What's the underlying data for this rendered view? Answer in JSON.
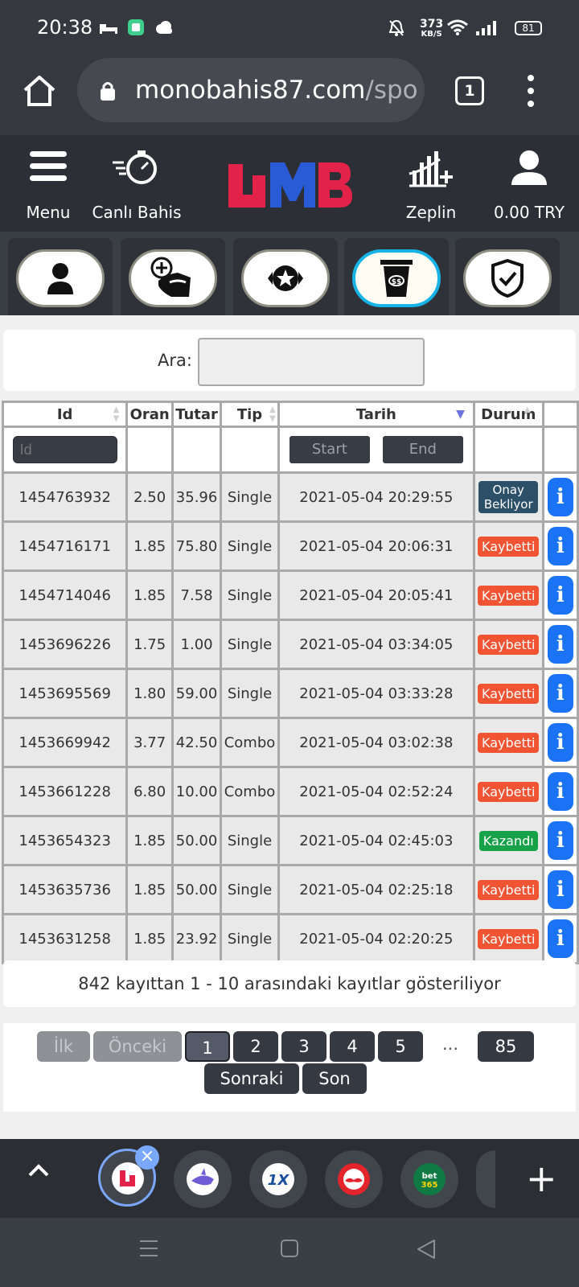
{
  "status_bar": {
    "time": "20:38",
    "net_speed_value": "373",
    "net_speed_unit": "KB/S",
    "battery": "81"
  },
  "browser": {
    "url_host": "monobahis87.com",
    "url_path": "/spor",
    "tab_count": "1"
  },
  "site_header": {
    "menu_label": "Menu",
    "live_label": "Canlı Bahis",
    "zeplin_label": "Zeplin",
    "balance_label": "0.00 TRY",
    "logo_text": "MB",
    "brand_colors": {
      "blue": "#2a5bd7",
      "red": "#e3224a"
    }
  },
  "icon_tabs": [
    {
      "icon": "user-icon"
    },
    {
      "icon": "deposit-icon"
    },
    {
      "icon": "star-badge-icon"
    },
    {
      "icon": "coupon-icon",
      "active": true
    },
    {
      "icon": "shield-check-icon"
    }
  ],
  "search": {
    "label": "Ara:",
    "value": ""
  },
  "table": {
    "headers": {
      "id": "Id",
      "oran": "Oran",
      "tutar": "Tutar",
      "tip": "Tip",
      "tarih": "Tarih",
      "durum": "Durum"
    },
    "filters": {
      "id_placeholder": "Id",
      "start": "Start",
      "end": "End"
    },
    "rows": [
      {
        "id": "1454763932",
        "oran": "2.50",
        "tutar": "35.96",
        "tip": "Single",
        "tarih": "2021-05-04 20:29:55",
        "durum": "Onay Bekliyor",
        "status": "pending"
      },
      {
        "id": "1454716171",
        "oran": "1.85",
        "tutar": "75.80",
        "tip": "Single",
        "tarih": "2021-05-04 20:06:31",
        "durum": "Kaybetti",
        "status": "lost"
      },
      {
        "id": "1454714046",
        "oran": "1.85",
        "tutar": "7.58",
        "tip": "Single",
        "tarih": "2021-05-04 20:05:41",
        "durum": "Kaybetti",
        "status": "lost"
      },
      {
        "id": "1453696226",
        "oran": "1.75",
        "tutar": "1.00",
        "tip": "Single",
        "tarih": "2021-05-04 03:34:05",
        "durum": "Kaybetti",
        "status": "lost"
      },
      {
        "id": "1453695569",
        "oran": "1.80",
        "tutar": "59.00",
        "tip": "Single",
        "tarih": "2021-05-04 03:33:28",
        "durum": "Kaybetti",
        "status": "lost"
      },
      {
        "id": "1453669942",
        "oran": "3.77",
        "tutar": "42.50",
        "tip": "Combo",
        "tarih": "2021-05-04 03:02:38",
        "durum": "Kaybetti",
        "status": "lost"
      },
      {
        "id": "1453661228",
        "oran": "6.80",
        "tutar": "10.00",
        "tip": "Combo",
        "tarih": "2021-05-04 02:52:24",
        "durum": "Kaybetti",
        "status": "lost"
      },
      {
        "id": "1453654323",
        "oran": "1.85",
        "tutar": "50.00",
        "tip": "Single",
        "tarih": "2021-05-04 02:45:03",
        "durum": "Kazandı",
        "status": "won"
      },
      {
        "id": "1453635736",
        "oran": "1.85",
        "tutar": "50.00",
        "tip": "Single",
        "tarih": "2021-05-04 02:25:18",
        "durum": "Kaybetti",
        "status": "lost"
      },
      {
        "id": "1453631258",
        "oran": "1.85",
        "tutar": "23.92",
        "tip": "Single",
        "tarih": "2021-05-04 02:20:25",
        "durum": "Kaybetti",
        "status": "lost"
      }
    ],
    "info_symbol": "i"
  },
  "summary": "842 kayıttan 1 - 10 arasındaki kayıtlar gösteriliyor",
  "pagination": {
    "first": "İlk",
    "prev": "Önceki",
    "pages": [
      "1",
      "2",
      "3",
      "4",
      "5"
    ],
    "current": "1",
    "ellipsis": "...",
    "last_page": "85",
    "next": "Sonraki",
    "last": "Son"
  },
  "dock": {
    "close_symbol": "×",
    "add_symbol": "+",
    "apps": [
      {
        "icon": "monobahis-app-icon",
        "active": true
      },
      {
        "icon": "shark-app-icon"
      },
      {
        "icon": "1xbet-app-icon",
        "text": "1X"
      },
      {
        "icon": "mustache-app-icon"
      },
      {
        "icon": "bet365-app-icon",
        "text": "bet365"
      }
    ]
  }
}
